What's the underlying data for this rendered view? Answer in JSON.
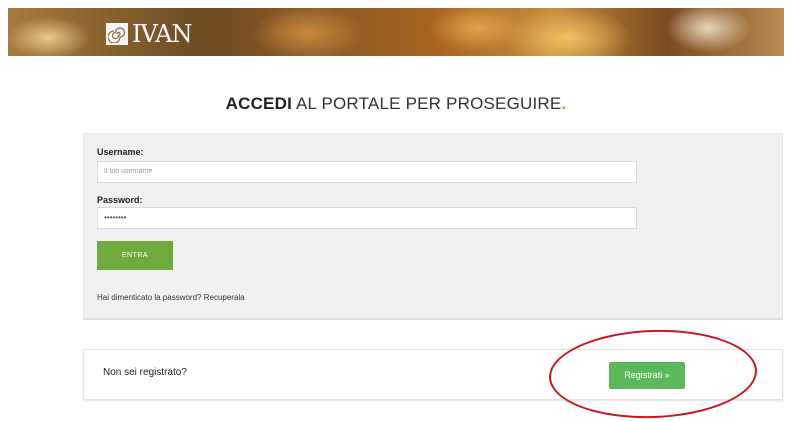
{
  "header": {
    "logo_text": "IVAN",
    "logo_icon": "spiral-icon"
  },
  "title": {
    "bold": "ACCEDI",
    "rest": " AL PORTALE PER PROSEGUIRE",
    "dot": "."
  },
  "login": {
    "username_label": "Username:",
    "username_placeholder": "Il tuo username",
    "password_label": "Password:",
    "password_value": "••••••••",
    "submit_label": "ENTRA",
    "forgot_text": "Hai dimenticato la password? Recuperala"
  },
  "register": {
    "prompt": "Non sei registrato?",
    "button_label": "Registrati »"
  },
  "colors": {
    "accent_green": "#6faa3f",
    "register_green": "#5cb85c",
    "annotation_red": "#c9161d"
  }
}
